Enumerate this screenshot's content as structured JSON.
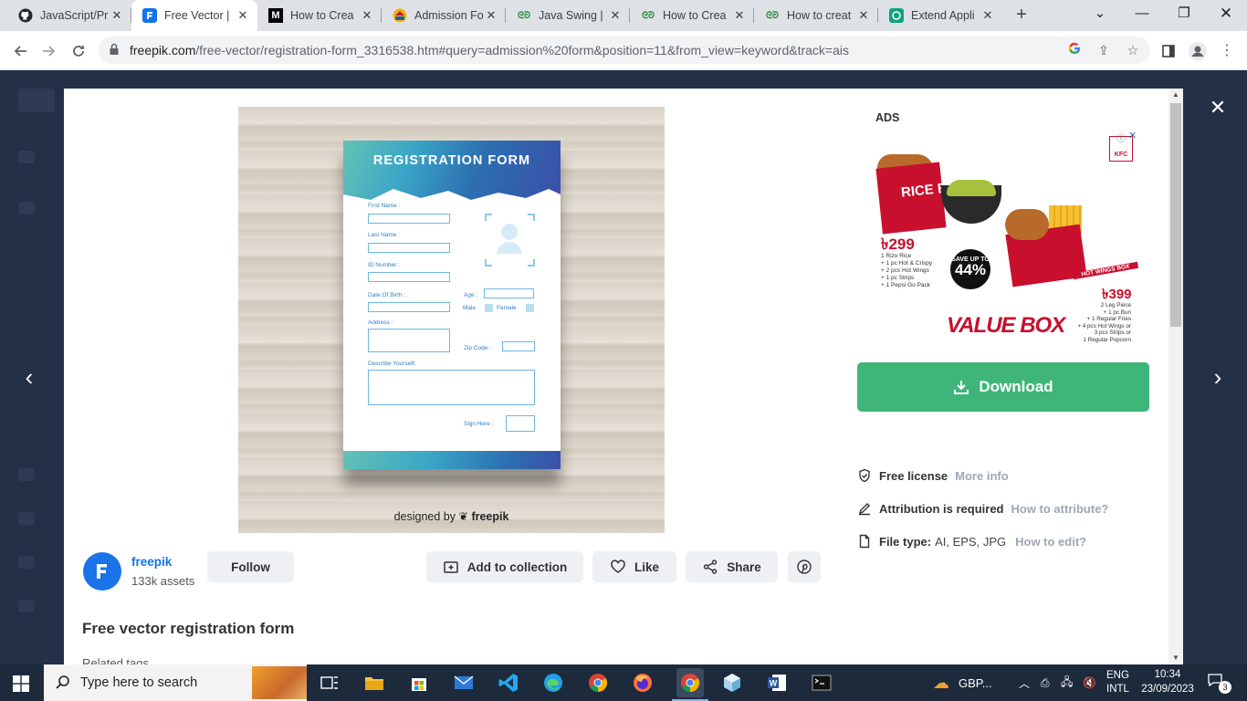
{
  "browser": {
    "tabs": [
      {
        "title": "JavaScript/Pr",
        "icon": "github-icon",
        "active": false
      },
      {
        "title": "Free Vector |",
        "icon": "freepik-icon",
        "active": true
      },
      {
        "title": "How to Crea",
        "icon": "medium-icon",
        "active": false
      },
      {
        "title": "Admission Fo",
        "icon": "school-icon",
        "active": false
      },
      {
        "title": "Java Swing |",
        "icon": "geeksforgeeks-icon",
        "active": false
      },
      {
        "title": "How to Crea",
        "icon": "geeksforgeeks-icon",
        "active": false
      },
      {
        "title": "How to creat",
        "icon": "geeksforgeeks-icon",
        "active": false
      },
      {
        "title": "Extend Appli",
        "icon": "chatgpt-icon",
        "active": false
      }
    ],
    "url_host": "freepik.com",
    "url_path": "/free-vector/registration-form_3316538.htm#query=admission%20form&position=11&from_view=keyword&track=ais"
  },
  "preview": {
    "form_title": "REGISTRATION FORM",
    "fields": {
      "first_name": "First Name :",
      "last_name": "Last Name :",
      "id_number": "ID Number :",
      "dob": "Date Of Birth :",
      "age": "Age :",
      "male": "Male",
      "female": "Female",
      "address": "Address :",
      "zip": "Zip Code :",
      "describe": "Describe Yourself:",
      "sign": "Sign Here :"
    },
    "credit_prefix": "designed by",
    "credit_brand": "freepik"
  },
  "ads": {
    "label": "ADS",
    "rice_box": "RICE BOX",
    "price1": "৳299",
    "items1": [
      "1 Rizo Rice",
      "+ 1 pc Hot & Crispy",
      "+ 2 pcs Hot Wings",
      "+ 1 pc Strips",
      "+ 1 Pepsi Go Pack"
    ],
    "save_line1": "SAVE UP TO",
    "save_line2": "44%",
    "wings_box": "HOT WINGS BOX",
    "price2": "৳399",
    "items2": [
      "2 Leg Piece",
      "+ 1 pc Bun",
      "+ 1 Regular Fries",
      "+ 4 pcs Hot Wings or",
      "3 pcs Strips or",
      "1 Regular Popcorn"
    ],
    "value_box": "VALUE BOX",
    "brand": "KFC"
  },
  "actions": {
    "download": "Download",
    "license_main": "Free license",
    "license_link": "More info",
    "attribution_main": "Attribution is required",
    "attribution_link": "How to attribute?",
    "filetype_main": "File type:",
    "filetype_value": "AI, EPS, JPG",
    "filetype_link": "How to edit?"
  },
  "author": {
    "name": "freepik",
    "assets": "133k assets",
    "follow": "Follow",
    "add_collection": "Add to collection",
    "like": "Like",
    "share": "Share"
  },
  "page": {
    "title": "Free vector registration form",
    "related": "Related tags"
  },
  "taskbar": {
    "search_placeholder": "Type here to search",
    "weather": "GBP...",
    "lang1": "ENG",
    "lang2": "INTL",
    "time": "10:34",
    "date": "23/09/2023",
    "notifications": "3"
  },
  "colors": {
    "download_green": "#3fb57a",
    "link_blue": "#1273eb",
    "kfc_red": "#c8102e"
  }
}
